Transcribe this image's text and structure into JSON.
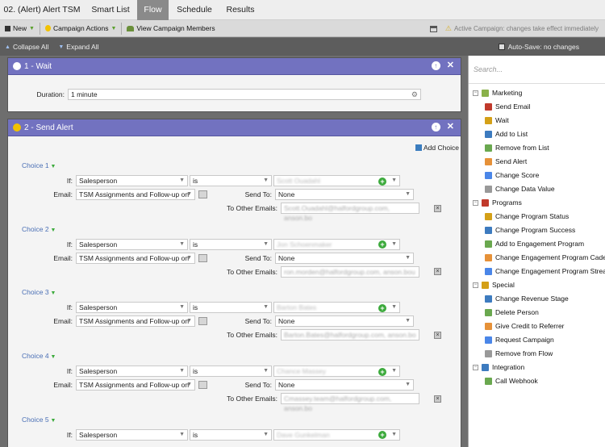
{
  "tabs": [
    {
      "label": "02. (Alert) Alert TSM",
      "active": false
    },
    {
      "label": "Smart List",
      "active": false
    },
    {
      "label": "Flow",
      "active": true
    },
    {
      "label": "Schedule",
      "active": false
    },
    {
      "label": "Results",
      "active": false
    }
  ],
  "toolbar1": {
    "new_label": "New",
    "campaign_actions_label": "Campaign Actions",
    "view_members_label": "View Campaign Members",
    "active_notice": "Active Campaign: changes take effect immediately"
  },
  "toolbar2": {
    "collapse_label": "Collapse All",
    "expand_label": "Expand All",
    "autosave_label": "Auto-Save: no changes"
  },
  "wait_step": {
    "title": "1 - Wait",
    "duration_label": "Duration:",
    "duration_value": "1 minute"
  },
  "alert_step": {
    "title": "2 - Send Alert",
    "add_choice_label": "Add Choice",
    "if_label": "If:",
    "email_label": "Email:",
    "send_to_label": "Send To:",
    "other_emails_label": "To Other Emails:",
    "choices": [
      {
        "label": "Choice 1",
        "attribute": "Salesperson",
        "operator": "is",
        "value": "Scott Ouadahl",
        "email": "TSM Assignments and Follow-up on",
        "send_to": "None",
        "other_emails": "Scott.Ouadahl@halfordgroup.com, anson.bo"
      },
      {
        "label": "Choice 2",
        "attribute": "Salesperson",
        "operator": "is",
        "value": "Jon Schoenmaker",
        "email": "TSM Assignments and Follow-up on",
        "send_to": "None",
        "other_emails": "ron.morden@halfordgroup.com, anson.bou"
      },
      {
        "label": "Choice 3",
        "attribute": "Salesperson",
        "operator": "is",
        "value": "Barton Bates",
        "email": "TSM Assignments and Follow-up on",
        "send_to": "None",
        "other_emails": "Barton.Bates@halfordgroup.com, anson.bo"
      },
      {
        "label": "Choice 4",
        "attribute": "Salesperson",
        "operator": "is",
        "value": "Chance Massey",
        "email": "TSM Assignments and Follow-up on",
        "send_to": "None",
        "other_emails": "Cmassey.team@halfordgroup.com, anson.bo"
      },
      {
        "label": "Choice 5",
        "attribute": "Salesperson",
        "operator": "is",
        "value": "Dave Gunkelman",
        "email": "",
        "send_to": "",
        "other_emails": ""
      }
    ]
  },
  "sidebar": {
    "search_placeholder": "Search...",
    "groups": [
      {
        "label": "Marketing",
        "items": [
          "Send Email",
          "Wait",
          "Add to List",
          "Remove from List",
          "Send Alert",
          "Change Score",
          "Change Data Value"
        ]
      },
      {
        "label": "Programs",
        "items": [
          "Change Program Status",
          "Change Program Success",
          "Add to Engagement Program",
          "Change Engagement Program Cadence",
          "Change Engagement Program Stream"
        ]
      },
      {
        "label": "Special",
        "items": [
          "Change Revenue Stage",
          "Delete Person",
          "Give Credit to Referrer",
          "Request Campaign",
          "Remove from Flow"
        ]
      },
      {
        "label": "Integration",
        "items": [
          "Call Webhook"
        ]
      }
    ]
  },
  "colors": {
    "panel_header": "#7272c0",
    "choice_link": "#4a6fb5",
    "add_green": "#3caa3c"
  }
}
